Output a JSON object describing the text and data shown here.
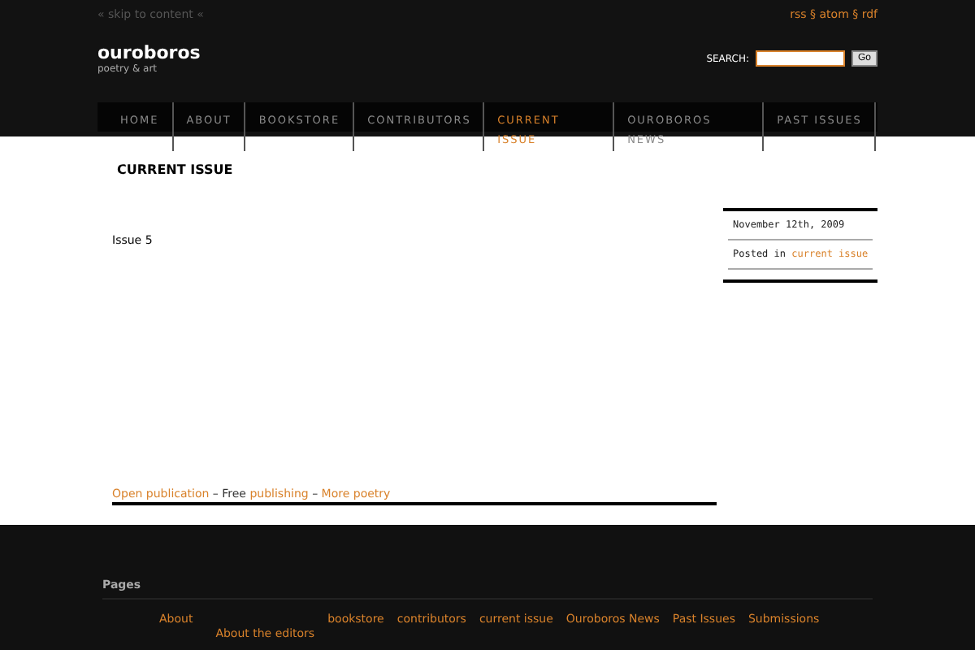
{
  "header": {
    "skip_link": "« skip to content «",
    "feeds": "rss § atom § rdf",
    "site_title": "ouroboros",
    "tagline": "poetry & art",
    "search": {
      "label": "SEARCH:",
      "button": "Go"
    }
  },
  "nav": [
    {
      "label": "HOME",
      "selected": false
    },
    {
      "label": "ABOUT",
      "selected": false
    },
    {
      "label": "BOOKSTORE",
      "selected": false
    },
    {
      "label": "CONTRIBUTORS",
      "selected": false
    },
    {
      "label": "CURRENT ISSUE",
      "selected": true
    },
    {
      "label": "OUROBOROS NEWS",
      "selected": false
    },
    {
      "label": "PAST ISSUES",
      "selected": false
    }
  ],
  "post": {
    "title": "CURRENT ISSUE",
    "body": "Issue 5"
  },
  "meta": {
    "date": "November 12th, 2009",
    "posted_in": "Posted in",
    "category": "current issue"
  },
  "credits": [
    {
      "text": "Open publication",
      "link": true
    },
    {
      "text": " – Free ",
      "link": false
    },
    {
      "text": "publishing",
      "link": true
    },
    {
      "text": " – ",
      "link": false
    },
    {
      "text": "More poetry",
      "link": true
    }
  ],
  "footer": {
    "heading": "Pages",
    "pages": [
      {
        "label": "About",
        "children": [
          {
            "label": "About the editors"
          }
        ]
      },
      {
        "label": "bookstore"
      },
      {
        "label": "contributors"
      },
      {
        "label": "current issue"
      },
      {
        "label": "Ouroboros News"
      },
      {
        "label": "Past Issues"
      },
      {
        "label": "Submissions"
      }
    ]
  }
}
